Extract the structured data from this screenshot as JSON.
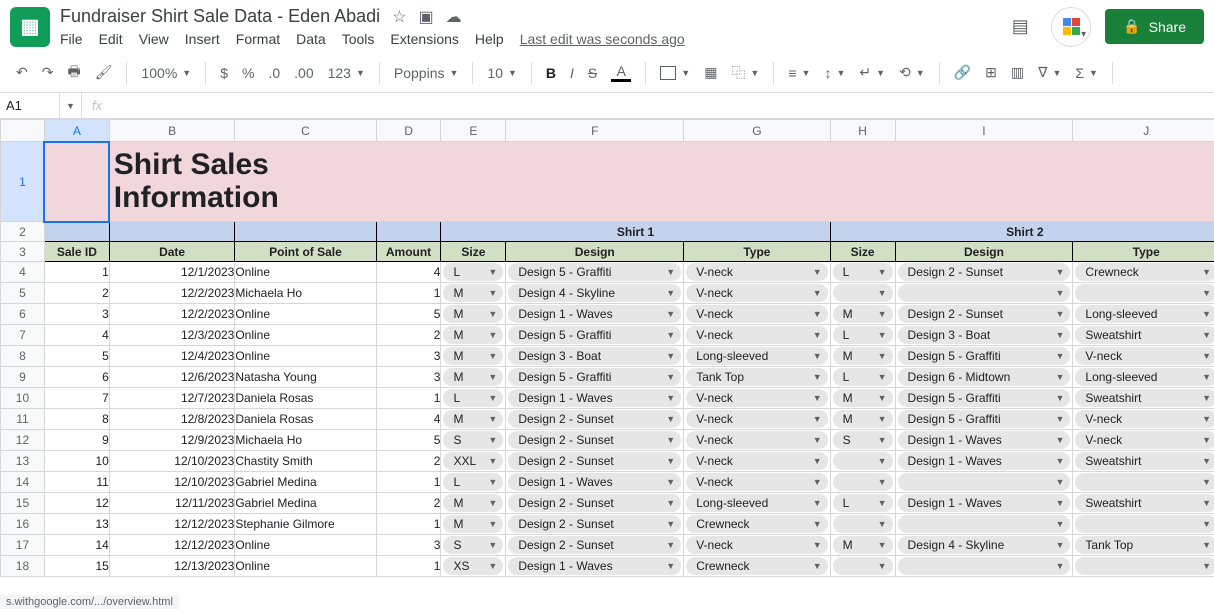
{
  "doc": {
    "title": "Fundraiser Shirt Sale Data - Eden Abadi",
    "last_edit": "Last edit was seconds ago"
  },
  "menus": [
    "File",
    "Edit",
    "View",
    "Insert",
    "Format",
    "Data",
    "Tools",
    "Extensions",
    "Help"
  ],
  "share_label": "Share",
  "toolbar": {
    "zoom": "100%",
    "currency": "$",
    "percent": "%",
    "dec_dec": ".0",
    "inc_dec": ".00",
    "num_fmt": "123",
    "font": "Poppins",
    "size": "10",
    "bold": "B",
    "italic": "I",
    "strike": "S",
    "textcolor": "A",
    "sigma": "Σ"
  },
  "name_box": "A1",
  "fx_label": "fx",
  "columns": [
    "A",
    "B",
    "C",
    "D",
    "E",
    "F",
    "G",
    "H",
    "I",
    "J"
  ],
  "sheet_title": "Shirt Sales Information",
  "section_headers": {
    "shirt1": "Shirt 1",
    "shirt2": "Shirt 2"
  },
  "col_headers": {
    "sale_id": "Sale ID",
    "date": "Date",
    "pos": "Point of Sale",
    "amount": "Amount",
    "size": "Size",
    "design": "Design",
    "type": "Type"
  },
  "rows": [
    {
      "n": 4,
      "id": 1,
      "date": "12/1/2023",
      "pos": "Online",
      "amt": 4,
      "s1": {
        "size": "L",
        "design": "Design 5 - Graffiti",
        "type": "V-neck"
      },
      "s2": {
        "size": "L",
        "design": "Design 2 - Sunset",
        "type": "Crewneck"
      }
    },
    {
      "n": 5,
      "id": 2,
      "date": "12/2/2023",
      "pos": "Michaela Ho",
      "amt": 1,
      "s1": {
        "size": "M",
        "design": "Design 4 - Skyline",
        "type": "V-neck"
      },
      "s2": {
        "size": "",
        "design": "",
        "type": ""
      }
    },
    {
      "n": 6,
      "id": 3,
      "date": "12/2/2023",
      "pos": "Online",
      "amt": 5,
      "s1": {
        "size": "M",
        "design": "Design 1 - Waves",
        "type": "V-neck"
      },
      "s2": {
        "size": "M",
        "design": "Design 2 - Sunset",
        "type": "Long-sleeved"
      }
    },
    {
      "n": 7,
      "id": 4,
      "date": "12/3/2023",
      "pos": "Online",
      "amt": 2,
      "s1": {
        "size": "M",
        "design": "Design 5 - Graffiti",
        "type": "V-neck"
      },
      "s2": {
        "size": "L",
        "design": "Design 3 - Boat",
        "type": "Sweatshirt"
      }
    },
    {
      "n": 8,
      "id": 5,
      "date": "12/4/2023",
      "pos": "Online",
      "amt": 3,
      "s1": {
        "size": "M",
        "design": "Design 3 - Boat",
        "type": "Long-sleeved"
      },
      "s2": {
        "size": "M",
        "design": "Design 5 - Graffiti",
        "type": "V-neck"
      }
    },
    {
      "n": 9,
      "id": 6,
      "date": "12/6/2023",
      "pos": "Natasha Young",
      "amt": 3,
      "s1": {
        "size": "M",
        "design": "Design 5 - Graffiti",
        "type": "Tank Top"
      },
      "s2": {
        "size": "L",
        "design": "Design 6 - Midtown",
        "type": "Long-sleeved"
      }
    },
    {
      "n": 10,
      "id": 7,
      "date": "12/7/2023",
      "pos": "Daniela Rosas",
      "amt": 1,
      "s1": {
        "size": "L",
        "design": "Design 1 - Waves",
        "type": "V-neck"
      },
      "s2": {
        "size": "M",
        "design": "Design 5 - Graffiti",
        "type": "Sweatshirt"
      }
    },
    {
      "n": 11,
      "id": 8,
      "date": "12/8/2023",
      "pos": "Daniela Rosas",
      "amt": 4,
      "s1": {
        "size": "M",
        "design": "Design 2 - Sunset",
        "type": "V-neck"
      },
      "s2": {
        "size": "M",
        "design": "Design 5 - Graffiti",
        "type": "V-neck"
      }
    },
    {
      "n": 12,
      "id": 9,
      "date": "12/9/2023",
      "pos": "Michaela Ho",
      "amt": 5,
      "s1": {
        "size": "S",
        "design": "Design 2 - Sunset",
        "type": "V-neck"
      },
      "s2": {
        "size": "S",
        "design": "Design 1 - Waves",
        "type": "V-neck"
      }
    },
    {
      "n": 13,
      "id": 10,
      "date": "12/10/2023",
      "pos": "Chastity Smith",
      "amt": 2,
      "s1": {
        "size": "XXL",
        "design": "Design 2 - Sunset",
        "type": "V-neck"
      },
      "s2": {
        "size": "",
        "design": "Design 1 - Waves",
        "type": "Sweatshirt"
      }
    },
    {
      "n": 14,
      "id": 11,
      "date": "12/10/2023",
      "pos": "Gabriel Medina",
      "amt": 1,
      "s1": {
        "size": "L",
        "design": "Design 1 - Waves",
        "type": "V-neck"
      },
      "s2": {
        "size": "",
        "design": "",
        "type": ""
      }
    },
    {
      "n": 15,
      "id": 12,
      "date": "12/11/2023",
      "pos": "Gabriel Medina",
      "amt": 2,
      "s1": {
        "size": "M",
        "design": "Design 2 - Sunset",
        "type": "Long-sleeved"
      },
      "s2": {
        "size": "L",
        "design": "Design 1 - Waves",
        "type": "Sweatshirt"
      }
    },
    {
      "n": 16,
      "id": 13,
      "date": "12/12/2023",
      "pos": "Stephanie Gilmore",
      "amt": 1,
      "s1": {
        "size": "M",
        "design": "Design 2 - Sunset",
        "type": "Crewneck"
      },
      "s2": {
        "size": "",
        "design": "",
        "type": ""
      }
    },
    {
      "n": 17,
      "id": 14,
      "date": "12/12/2023",
      "pos": "Online",
      "amt": 3,
      "s1": {
        "size": "S",
        "design": "Design 2 - Sunset",
        "type": "V-neck"
      },
      "s2": {
        "size": "M",
        "design": "Design 4 - Skyline",
        "type": "Tank Top"
      }
    },
    {
      "n": 18,
      "id": 15,
      "date": "12/13/2023",
      "pos": "Online",
      "amt": 1,
      "s1": {
        "size": "XS",
        "design": "Design 1 - Waves",
        "type": "Crewneck"
      },
      "s2": {
        "size": "",
        "design": "",
        "type": ""
      }
    }
  ],
  "status_url": "s.withgoogle.com/.../overview.html"
}
